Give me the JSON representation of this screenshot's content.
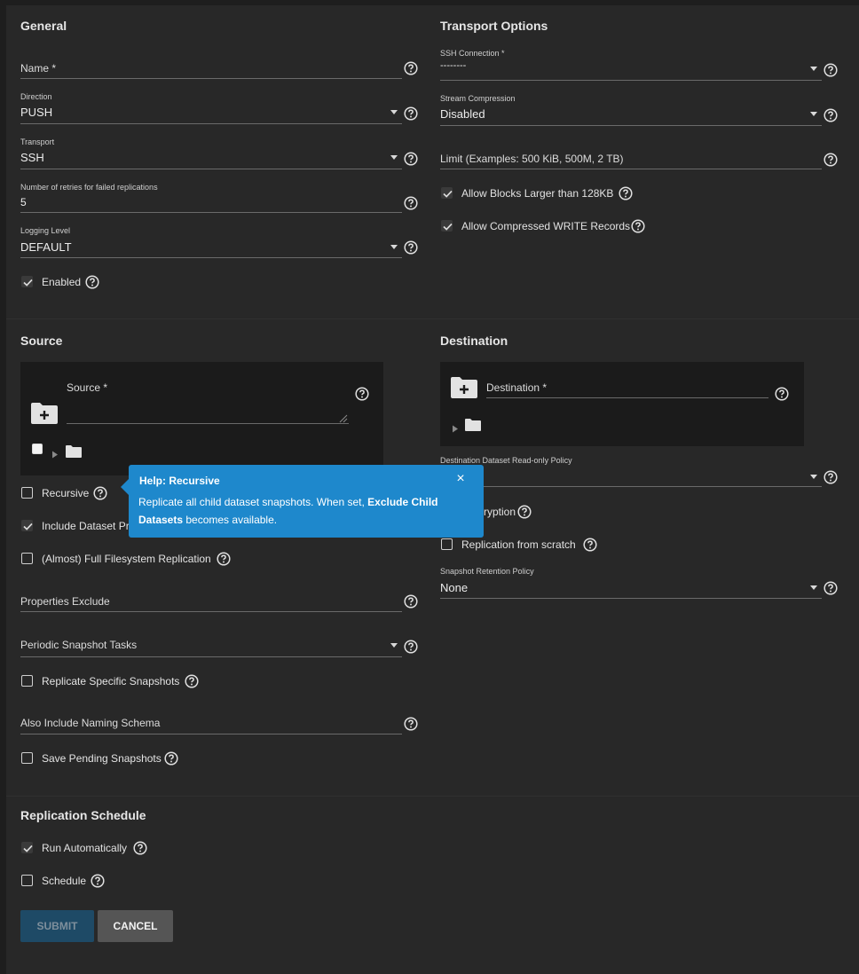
{
  "general": {
    "title": "General",
    "name_label": "Name *",
    "direction_label": "Direction",
    "direction_value": "PUSH",
    "transport_label": "Transport",
    "transport_value": "SSH",
    "retries_label": "Number of retries for failed replications",
    "retries_value": "5",
    "logging_label": "Logging Level",
    "logging_value": "DEFAULT",
    "enabled_label": "Enabled",
    "enabled_checked": true
  },
  "transport_options": {
    "title": "Transport Options",
    "ssh_label": "SSH Connection *",
    "ssh_value": "--------",
    "compression_label": "Stream Compression",
    "compression_value": "Disabled",
    "limit_placeholder": "Limit (Examples: 500 KiB, 500M, 2 TB)",
    "large_blocks_label": "Allow Blocks Larger than 128KB",
    "large_blocks_checked": true,
    "compressed_label": "Allow Compressed WRITE Records",
    "compressed_checked": true
  },
  "source": {
    "title": "Source",
    "source_label": "Source *",
    "recursive_label": "Recursive",
    "include_props_label": "Include Dataset Pr",
    "full_fs_label": "(Almost) Full Filesystem Replication",
    "properties_exclude_label": "Properties Exclude",
    "periodic_tasks_label": "Periodic Snapshot Tasks",
    "replicate_specific_label": "Replicate Specific Snapshots",
    "naming_schema_label": "Also Include Naming Schema",
    "save_pending_label": "Save Pending Snapshots"
  },
  "destination": {
    "title": "Destination",
    "destination_label": "Destination *",
    "readonly_policy_label": "Destination Dataset Read-only Policy",
    "encryption_label": "ryption",
    "from_scratch_label": "Replication from scratch",
    "retention_label": "Snapshot Retention Policy",
    "retention_value": "None"
  },
  "tooltip": {
    "title": "Help: Recursive",
    "text_before": "Replicate all child dataset snapshots. When set, ",
    "text_bold": "Exclude Child Datasets",
    "text_after": " becomes available.",
    "close": "×"
  },
  "schedule": {
    "title": "Replication Schedule",
    "run_auto_label": "Run Automatically",
    "schedule_label": "Schedule"
  },
  "buttons": {
    "submit": "SUBMIT",
    "cancel": "CANCEL"
  },
  "icons": {
    "help": "help-circle-icon",
    "folder": "folder-icon",
    "folder_add": "folder-plus-icon"
  },
  "colors": {
    "tooltip_bg": "#1e88cc",
    "submit_bg": "#1e4a66",
    "cancel_bg": "#555555"
  }
}
